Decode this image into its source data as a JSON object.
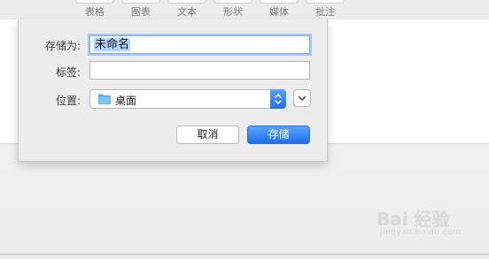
{
  "toolbar": {
    "items": [
      {
        "label": "表格"
      },
      {
        "label": "图表"
      },
      {
        "label": "文本"
      },
      {
        "label": "形状"
      },
      {
        "label": "媒体"
      },
      {
        "label": "批注"
      }
    ]
  },
  "save_dialog": {
    "save_as_label": "存储为:",
    "save_as_value": "未命名",
    "tags_label": "标签:",
    "tags_value": "",
    "location_label": "位置:",
    "location_value": "桌面",
    "location_icon": "folder-icon",
    "cancel_label": "取消",
    "save_label": "存储",
    "accent_color": "#1f6fe8"
  },
  "watermark": {
    "brand": "Bai 经验",
    "url": "jingyan.baidu.com"
  }
}
